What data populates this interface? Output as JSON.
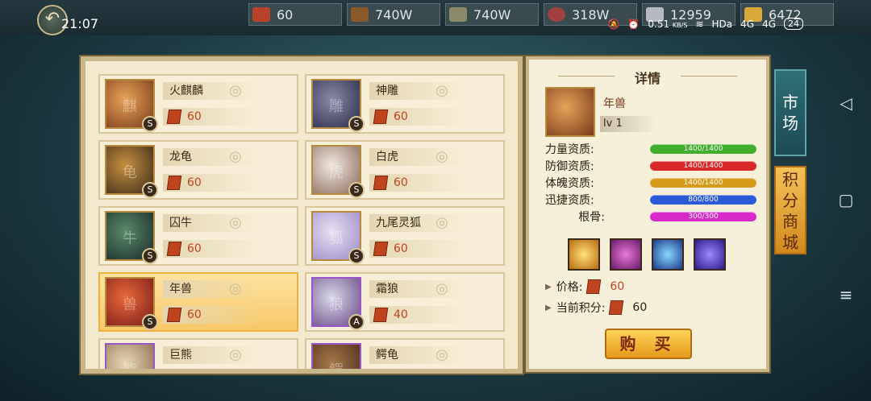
{
  "status": {
    "time": "21:07",
    "network_speed": "0.51",
    "network_unit": "KB/S",
    "hd": "HDa",
    "signal1": "4G",
    "signal2": "4G",
    "battery": "24"
  },
  "resources": [
    {
      "value": "60",
      "icon": "token-icon",
      "color": "#b8432a"
    },
    {
      "value": "740W",
      "icon": "wood-icon",
      "color": "#8a5a2a"
    },
    {
      "value": "740W",
      "icon": "stone-icon",
      "color": "#8a8a6a"
    },
    {
      "value": "318W",
      "icon": "meat-icon",
      "color": "#a04040"
    },
    {
      "value": "12959",
      "icon": "silver-icon",
      "color": "#b8b8c0"
    },
    {
      "value": "6472",
      "icon": "gold-ingot-icon",
      "color": "#d8a838"
    }
  ],
  "beasts": [
    {
      "name": "火麒麟",
      "price": "60",
      "grade": "S",
      "glyph": "麒"
    },
    {
      "name": "神雕",
      "price": "60",
      "grade": "S",
      "glyph": "雕"
    },
    {
      "name": "龙龟",
      "price": "60",
      "grade": "S",
      "glyph": "龟"
    },
    {
      "name": "白虎",
      "price": "60",
      "grade": "S",
      "glyph": "虎"
    },
    {
      "name": "囚牛",
      "price": "60",
      "grade": "S",
      "glyph": "牛"
    },
    {
      "name": "九尾灵狐",
      "price": "60",
      "grade": "S",
      "glyph": "狐"
    },
    {
      "name": "年兽",
      "price": "60",
      "grade": "S",
      "glyph": "兽"
    },
    {
      "name": "霜狼",
      "price": "40",
      "grade": "A",
      "glyph": "狼"
    },
    {
      "name": "巨熊",
      "price": "",
      "grade": "",
      "glyph": "熊"
    },
    {
      "name": "鳄龟",
      "price": "",
      "grade": "",
      "glyph": "鳄"
    }
  ],
  "detail": {
    "title": "详情",
    "name": "年兽",
    "level": "lv 1",
    "stats": [
      {
        "label": "力量资质:",
        "value": "1400/1400",
        "color": "#3fae2a"
      },
      {
        "label": "防御资质:",
        "value": "1400/1400",
        "color": "#d8282a"
      },
      {
        "label": "体魄资质:",
        "value": "1400/1400",
        "color": "#d89a1a"
      },
      {
        "label": "迅捷资质:",
        "value": "800/800",
        "color": "#2a5ad8"
      },
      {
        "label": "根骨:",
        "value": "300/300",
        "color": "#d82ac8"
      }
    ],
    "skills": [
      {
        "icon": "golden-burst-skill-icon",
        "color": "#e8a820"
      },
      {
        "icon": "shield-skill-icon",
        "color": "#b83aa8"
      },
      {
        "icon": "claw-strike-skill-icon",
        "color": "#2a7ad8"
      },
      {
        "icon": "lightning-skill-icon",
        "color": "#4a3ad8"
      }
    ],
    "price_label": "价格:",
    "price_value": "60",
    "points_label": "当前积分:",
    "points_value": "60",
    "buy_label": "购 买"
  },
  "tabs": {
    "market": "市场",
    "points_shop": "积分商城"
  }
}
